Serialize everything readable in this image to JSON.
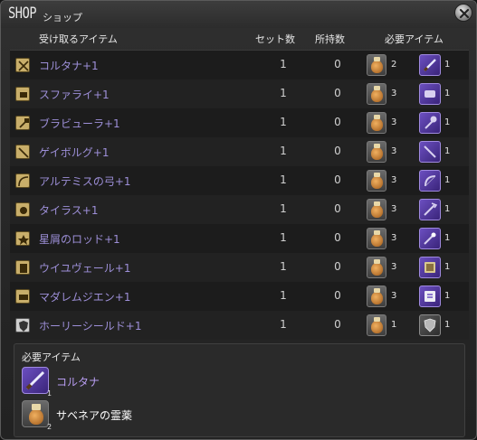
{
  "window": {
    "title": "SHOP",
    "subtitle": "ショップ"
  },
  "header": {
    "item": "受け取るアイテム",
    "set": "セット数",
    "owned": "所持数",
    "required": "必要アイテム"
  },
  "rows": [
    {
      "name": "コルタナ+1",
      "qty": "1",
      "owned": "0",
      "req1_qty": "2",
      "req2_qty": "1"
    },
    {
      "name": "スファライ+1",
      "qty": "1",
      "owned": "0",
      "req1_qty": "3",
      "req2_qty": "1"
    },
    {
      "name": "ブラビューラ+1",
      "qty": "1",
      "owned": "0",
      "req1_qty": "3",
      "req2_qty": "1"
    },
    {
      "name": "ゲイボルグ+1",
      "qty": "1",
      "owned": "0",
      "req1_qty": "3",
      "req2_qty": "1"
    },
    {
      "name": "アルテミスの弓+1",
      "qty": "1",
      "owned": "0",
      "req1_qty": "3",
      "req2_qty": "1"
    },
    {
      "name": "タイラス+1",
      "qty": "1",
      "owned": "0",
      "req1_qty": "3",
      "req2_qty": "1"
    },
    {
      "name": "星屑のロッド+1",
      "qty": "1",
      "owned": "0",
      "req1_qty": "3",
      "req2_qty": "1"
    },
    {
      "name": "ウイユヴェール+1",
      "qty": "1",
      "owned": "0",
      "req1_qty": "3",
      "req2_qty": "1"
    },
    {
      "name": "マダレムジエン+1",
      "qty": "1",
      "owned": "0",
      "req1_qty": "3",
      "req2_qty": "1"
    },
    {
      "name": "ホーリーシールド+1",
      "qty": "1",
      "owned": "0",
      "req1_qty": "1",
      "req2_qty": "1"
    }
  ],
  "detail": {
    "title": "必要アイテム",
    "items": [
      {
        "name": "コルタナ",
        "count": "1",
        "color": "#b79cf0",
        "icon": "dagger-icon"
      },
      {
        "name": "サベネアの霊薬",
        "count": "2",
        "color": "#ffffff",
        "icon": "potion-icon"
      }
    ]
  }
}
